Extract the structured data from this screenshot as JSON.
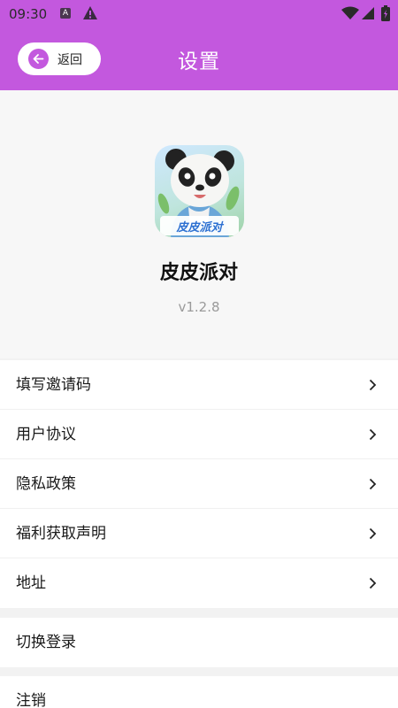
{
  "status_bar": {
    "time": "09:30",
    "icons": [
      "a-notification-icon",
      "warning-icon",
      "wifi-icon",
      "signal-icon",
      "battery-icon"
    ]
  },
  "header": {
    "title": "设置",
    "back_label": "返回",
    "color": "#c358de"
  },
  "app": {
    "name": "皮皮派对",
    "version": "v1.2.8",
    "logo_text": "皮皮派对"
  },
  "menu": {
    "group1": [
      {
        "label": "填写邀请码"
      },
      {
        "label": "用户协议"
      },
      {
        "label": "隐私政策"
      },
      {
        "label": "福利获取声明"
      },
      {
        "label": "地址"
      }
    ],
    "switch_login": "切换登录",
    "logout": "注销"
  }
}
